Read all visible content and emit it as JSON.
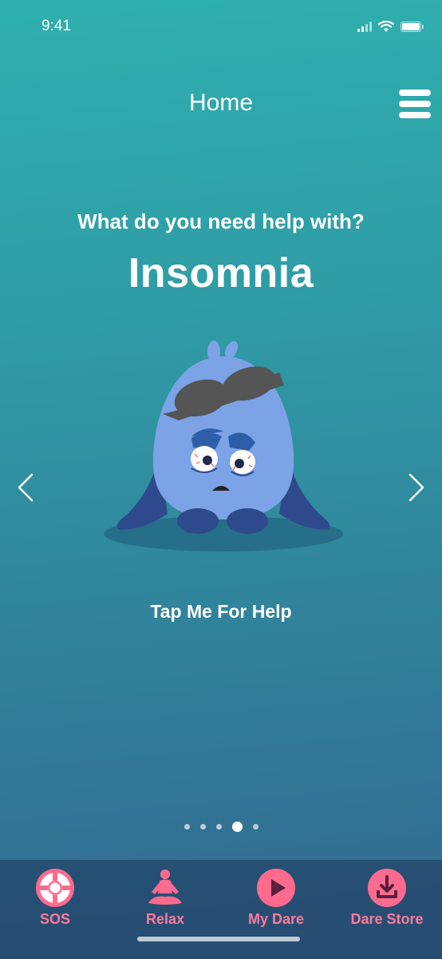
{
  "status_bar": {
    "time": "9:41"
  },
  "header": {
    "title": "Home"
  },
  "main": {
    "prompt": "What do you need help with?",
    "topic": "Insomnia",
    "action_label": "Tap Me For Help",
    "pager": {
      "count": 5,
      "active_index": 3
    }
  },
  "tab_bar": {
    "items": [
      {
        "label": "SOS",
        "icon": "lifebuoy-icon"
      },
      {
        "label": "Relax",
        "icon": "meditation-icon"
      },
      {
        "label": "My Dare",
        "icon": "play-icon"
      },
      {
        "label": "Dare Store",
        "icon": "download-icon"
      }
    ]
  },
  "colors": {
    "accent_pink": "#ff6b8e",
    "tab_label": "#ff7a9c",
    "mascot_body": "#7ba3e6",
    "mascot_dark": "#2f4a8c",
    "background_top": "#2fb0ae",
    "background_bottom": "#33678f"
  }
}
